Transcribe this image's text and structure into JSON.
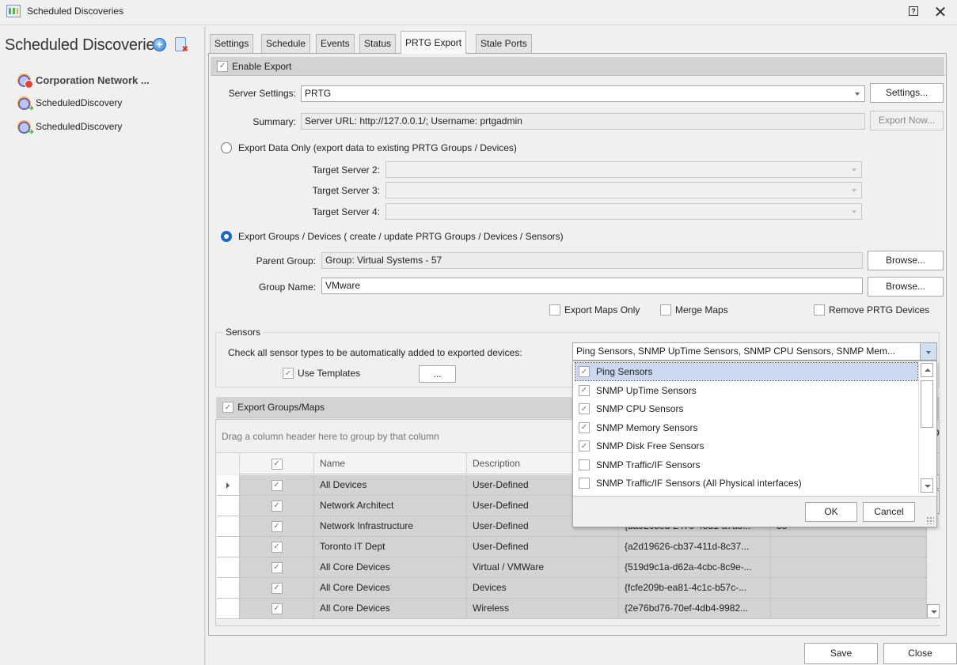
{
  "window": {
    "title": "Scheduled Discoveries",
    "help_glyph": "?",
    "close_glyph": "✕"
  },
  "left_panel": {
    "title": "Scheduled Discoveries",
    "title_visible": "Scheduled Discoverie",
    "add_glyph": "+",
    "items": [
      {
        "label": "Corporation Network ...",
        "status": "stopped"
      },
      {
        "label": "ScheduledDiscovery",
        "status": "active"
      },
      {
        "label": "ScheduledDiscovery",
        "status": "active"
      }
    ]
  },
  "tabs": [
    {
      "label": "Settings",
      "active": false
    },
    {
      "label": "Schedule",
      "active": false
    },
    {
      "label": "Events",
      "active": false
    },
    {
      "label": "Status",
      "active": false
    },
    {
      "label": "PRTG Export",
      "active": true
    },
    {
      "label": "Stale Ports",
      "active": false
    }
  ],
  "export": {
    "enable_label": "Enable Export",
    "enable_checked": true,
    "server_settings_label": "Server Settings:",
    "server_settings_value": "PRTG",
    "settings_button": "Settings...",
    "summary_label": "Summary:",
    "summary_value": "Server URL: http://127.0.0.1/; Username: prtgadmin",
    "export_now_button": "Export Now...",
    "mode_data_only_label": "Export Data Only (export data to existing PRTG Groups / Devices)",
    "mode_data_only_selected": false,
    "target_servers": [
      {
        "label": "Target Server 2:",
        "value": ""
      },
      {
        "label": "Target Server 3:",
        "value": ""
      },
      {
        "label": "Target Server 4:",
        "value": ""
      }
    ],
    "mode_groups_label": "Export Groups / Devices ( create / update PRTG Groups / Devices / Sensors)",
    "mode_groups_selected": true,
    "parent_group_label": "Parent Group:",
    "parent_group_value": "Group: Virtual Systems - 57",
    "group_name_label": "Group Name:",
    "group_name_value": "VMware",
    "browse_button": "Browse...",
    "export_maps_only_label": "Export Maps Only",
    "export_maps_only_checked": false,
    "merge_maps_label": "Merge Maps",
    "merge_maps_checked": false,
    "remove_devices_label": "Remove PRTG Devices",
    "remove_devices_checked": false
  },
  "sensors": {
    "legend": "Sensors",
    "prompt": "Check all sensor types to be automatically added to exported devices:",
    "combo_value": "Ping Sensors, SNMP UpTime Sensors, SNMP CPU Sensors, SNMP Mem...",
    "use_templates_label": "Use Templates",
    "use_templates_checked": true,
    "ellipsis_button": "...",
    "options": [
      {
        "label": "Ping Sensors",
        "checked": true,
        "highlighted": true
      },
      {
        "label": "SNMP UpTime Sensors",
        "checked": true
      },
      {
        "label": "SNMP CPU Sensors",
        "checked": true
      },
      {
        "label": "SNMP Memory Sensors",
        "checked": true
      },
      {
        "label": "SNMP Disk Free Sensors",
        "checked": true
      },
      {
        "label": "SNMP Traffic/IF Sensors",
        "checked": false
      },
      {
        "label": "SNMP Traffic/IF Sensors (All Physical interfaces)",
        "checked": false
      }
    ],
    "ok_button": "OK",
    "cancel_button": "Cancel"
  },
  "groups_maps": {
    "header_label": "Export Groups/Maps",
    "header_checked": true,
    "group_panel_text": "Drag a column header here to group by that column",
    "columns": [
      "",
      "Name",
      "Description",
      "",
      ""
    ],
    "rows": [
      {
        "checked": true,
        "name": "All Devices",
        "description": "User-Defined",
        "id": "",
        "extra": "",
        "current": true
      },
      {
        "checked": true,
        "name": "Network Architect",
        "description": "User-Defined",
        "id": "",
        "extra": ""
      },
      {
        "checked": true,
        "name": "Network Infrastructure",
        "description": "User-Defined",
        "id": "{da9205ed-2470-45d1-a7a9...",
        "extra": "55"
      },
      {
        "checked": true,
        "name": "Toronto IT Dept",
        "description": "User-Defined",
        "id": "{a2d19626-cb37-411d-8c37...",
        "extra": ""
      },
      {
        "checked": true,
        "name": "All Core Devices",
        "description": "Virtual / VMWare",
        "id": "{519d9c1a-d62a-4cbc-8c9e-...",
        "extra": ""
      },
      {
        "checked": true,
        "name": "All Core Devices",
        "description": "Devices",
        "id": "{fcfe209b-ea81-4c1c-b57c-...",
        "extra": ""
      },
      {
        "checked": true,
        "name": "All Core Devices",
        "description": "Wireless",
        "id": "{2e76bd76-70ef-4db4-9982...",
        "extra": ""
      }
    ]
  },
  "footer": {
    "save_button": "Save",
    "close_button": "Close"
  }
}
